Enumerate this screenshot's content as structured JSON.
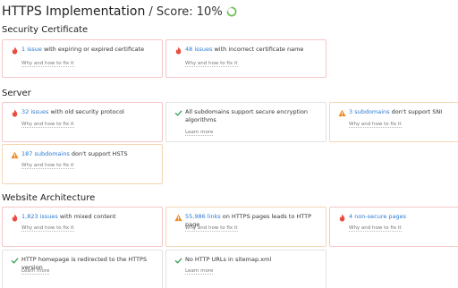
{
  "header": {
    "title": "HTTPS Implementation",
    "score": "/ Score: 10%"
  },
  "sections": {
    "security": {
      "title": "Security Certificate",
      "cards": [
        {
          "type": "error",
          "count": "1 issue",
          "text": " with expiring or expired certificate",
          "help": "Why and how to fix it"
        },
        {
          "type": "error",
          "count": "48 issues",
          "text": " with incorrect certificate name",
          "help": "Why and how to fix it"
        }
      ]
    },
    "server": {
      "title": "Server",
      "cards": [
        {
          "type": "error",
          "count": "32 issues",
          "text": " with old security protocol",
          "help": "Why and how to fix it"
        },
        {
          "type": "ok",
          "count": "",
          "text": "All subdomains support secure encryption algorithms",
          "help": "Learn more"
        },
        {
          "type": "warning",
          "count": "3 subdomains",
          "text": " don't support SNI",
          "help": "Why and how to fix it"
        },
        {
          "type": "warning",
          "count": "187 subdomains",
          "text": " don't support HSTS",
          "help": "Why and how to fix it"
        }
      ]
    },
    "architecture": {
      "title": "Website Architecture",
      "cards": [
        {
          "type": "error",
          "count": "1,823 issues",
          "text": " with mixed content",
          "help": "Why and how to fix it"
        },
        {
          "type": "warning",
          "count": "55,986 links",
          "text": " on HTTPS pages leads to HTTP page",
          "help": "Why and how to fix it"
        },
        {
          "type": "error",
          "count": "4 non-secure pages",
          "text": "",
          "help": "Why and how to fix it"
        },
        {
          "type": "ok",
          "count": "",
          "text": "HTTP homepage is redirected to the HTTPS version",
          "help": "Learn more"
        },
        {
          "type": "ok",
          "count": "",
          "text": "No HTTP URLs in sitemap.xml",
          "help": "Learn more"
        }
      ]
    }
  },
  "colors": {
    "link": "#2b7bd2",
    "error": "#e84a3c",
    "warning": "#f08a24",
    "ok": "#3aa15b",
    "spinner": "#6cc04a"
  },
  "icons": {
    "error": "fire-icon",
    "warning": "warning-triangle-icon",
    "ok": "checkmark-icon",
    "spinner": "progress-spinner-icon"
  }
}
